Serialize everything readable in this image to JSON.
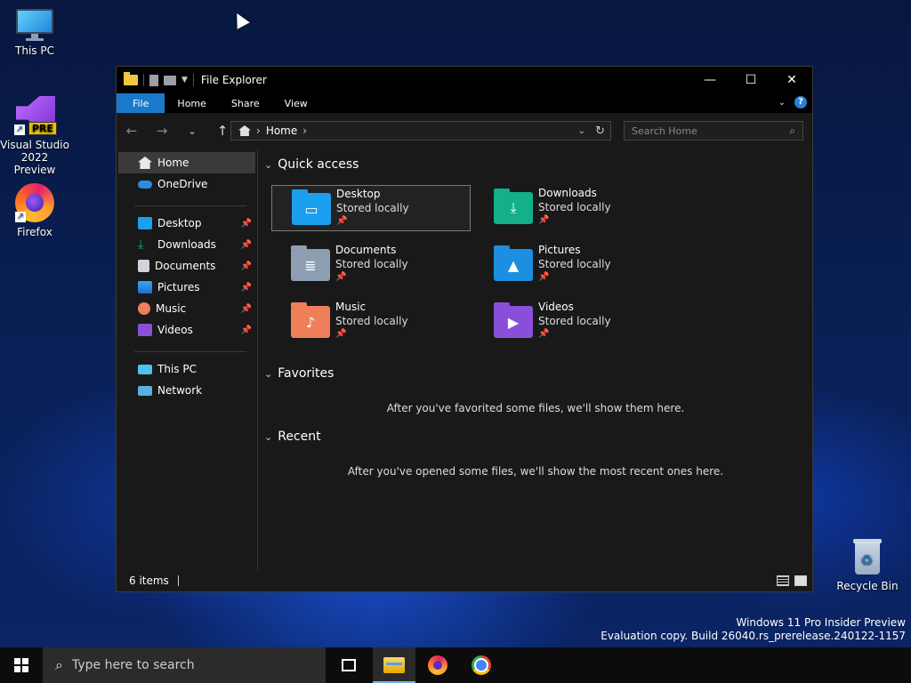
{
  "desktop": {
    "icons": [
      {
        "label": "This PC"
      },
      {
        "label": "Visual Studio 2022 Preview",
        "badge": "PRE"
      },
      {
        "label": "Firefox"
      },
      {
        "label": "Recycle Bin"
      }
    ]
  },
  "window": {
    "title": "File Explorer",
    "controls": {
      "minimize": "—",
      "maximize": "☐",
      "close": "✕"
    },
    "ribbon": {
      "tabs": [
        "File",
        "Home",
        "Share",
        "View"
      ],
      "help": "?"
    },
    "address": {
      "crumb": "Home"
    },
    "search": {
      "placeholder": "Search Home"
    },
    "nav": {
      "top": [
        {
          "label": "Home",
          "icon": "home-icon"
        },
        {
          "label": "OneDrive",
          "icon": "onedrive-icon"
        }
      ],
      "pinned": [
        {
          "label": "Desktop",
          "icon": "desktop-folder-icon"
        },
        {
          "label": "Downloads",
          "icon": "downloads-folder-icon"
        },
        {
          "label": "Documents",
          "icon": "documents-folder-icon"
        },
        {
          "label": "Pictures",
          "icon": "pictures-folder-icon"
        },
        {
          "label": "Music",
          "icon": "music-folder-icon"
        },
        {
          "label": "Videos",
          "icon": "videos-folder-icon"
        }
      ],
      "bottom": [
        {
          "label": "This PC",
          "icon": "this-pc-icon"
        },
        {
          "label": "Network",
          "icon": "network-icon"
        }
      ]
    },
    "quick_access": {
      "heading": "Quick access",
      "items": [
        {
          "name": "Desktop",
          "status": "Stored locally",
          "color": "#1aa0ee"
        },
        {
          "name": "Downloads",
          "status": "Stored locally",
          "color": "#13b08a"
        },
        {
          "name": "Documents",
          "status": "Stored locally",
          "color": "#8f9fb3"
        },
        {
          "name": "Pictures",
          "status": "Stored locally",
          "color": "#1d8fe0"
        },
        {
          "name": "Music",
          "status": "Stored locally",
          "color": "#ee7f5a"
        },
        {
          "name": "Videos",
          "status": "Stored locally",
          "color": "#8a4fd8"
        }
      ]
    },
    "favorites": {
      "heading": "Favorites",
      "message": "After you've favorited some files, we'll show them here."
    },
    "recent": {
      "heading": "Recent",
      "message": "After you've opened some files, we'll show the most recent ones here."
    },
    "status": {
      "count": "6 items"
    }
  },
  "watermark": {
    "line1": "Windows 11 Pro Insider Preview",
    "line2": "Evaluation copy. Build 26040.rs_prerelease.240122-1157"
  },
  "taskbar": {
    "search_placeholder": "Type here to search"
  }
}
